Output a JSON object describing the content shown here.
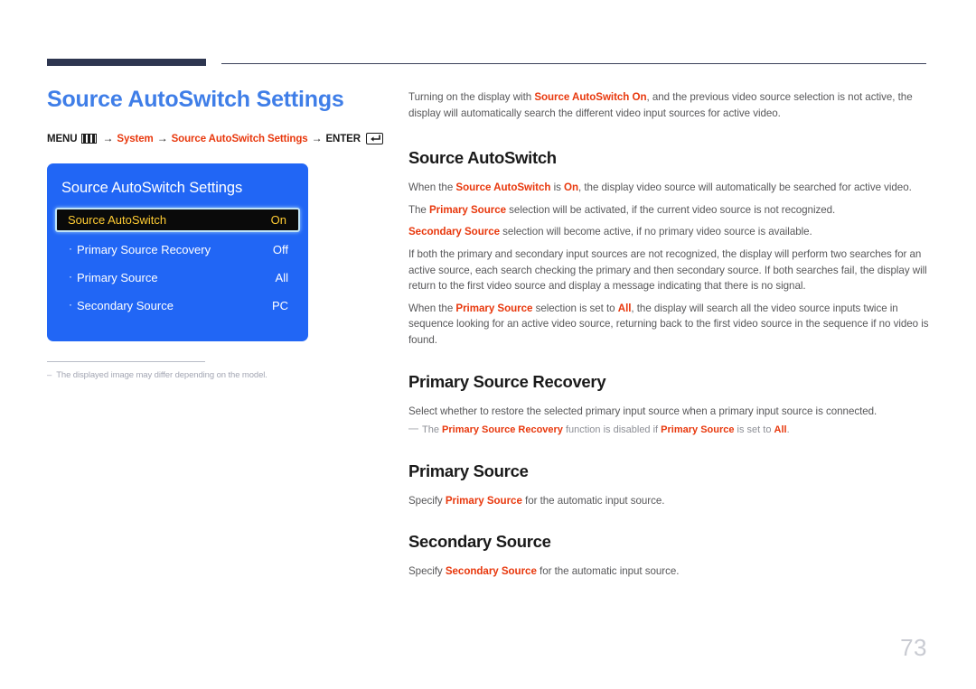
{
  "header": {
    "rule_color": "#2e3650"
  },
  "left": {
    "title": "Source AutoSwitch Settings",
    "menu_path": {
      "menu_label": "MENU",
      "menu_icon": "menu-grid-icon",
      "arrow": "→",
      "step1": "System",
      "step2": "Source AutoSwitch Settings",
      "enter_label": "ENTER",
      "enter_icon": "enter-return-icon"
    },
    "osd": {
      "title": "Source AutoSwitch Settings",
      "accent_color": "#2166f5",
      "highlight_text_color": "#ffcc33",
      "rows": [
        {
          "bullet": "",
          "label": "Source AutoSwitch",
          "value": "On",
          "selected": true
        },
        {
          "bullet": "·",
          "label": "Primary Source Recovery",
          "value": "Off",
          "selected": false
        },
        {
          "bullet": "·",
          "label": "Primary Source",
          "value": "All",
          "selected": false
        },
        {
          "bullet": "·",
          "label": "Secondary Source",
          "value": "PC",
          "selected": false
        }
      ]
    },
    "note": {
      "dash": "–",
      "text": "The displayed image may differ depending on the model."
    }
  },
  "right": {
    "intro": {
      "part1": "Turning on the display with ",
      "accent1": "Source AutoSwitch On",
      "part2": ", and the previous video source selection is not active, the display will automatically search the different video input sources for active video."
    },
    "sections": [
      {
        "heading": "Source AutoSwitch",
        "paragraphs": [
          {
            "p1": "When the ",
            "a1": "Source AutoSwitch",
            "p2": " is ",
            "a2": "On",
            "p3": ", the display video source will automatically be searched for active video."
          },
          {
            "p1": "The ",
            "a1": "Primary Source",
            "p2": " selection will be activated, if the current video source is not recognized.",
            "a2": "",
            "p3": ""
          },
          {
            "p1": "",
            "a1": "Secondary Source",
            "p2": " selection will become active, if no primary video source is available.",
            "a2": "",
            "p3": ""
          },
          {
            "p1": "If both the primary and secondary input sources are not recognized, the display will perform two searches for an active source, each search checking the primary and then secondary source. If both searches fail, the display will return to the first video source and display a message indicating that there is no signal.",
            "a1": "",
            "p2": "",
            "a2": "",
            "p3": ""
          },
          {
            "p1": "When the ",
            "a1": "Primary Source",
            "p2": " selection is set to ",
            "a2": "All",
            "p3": ", the display will search all the video source inputs twice in sequence looking for an active video source, returning back to the first video source in the sequence if no video is found."
          }
        ]
      }
    ],
    "recovery": {
      "heading": "Primary Source Recovery",
      "body": "Select whether to restore the selected primary input source when a primary input source is connected.",
      "note_dash": "—",
      "note_p1": "The ",
      "note_a1": "Primary Source Recovery",
      "note_p2": " function is disabled if ",
      "note_a2": "Primary Source",
      "note_p3": " is set to ",
      "note_a3": "All",
      "note_p4": "."
    },
    "primary_source": {
      "heading": "Primary Source",
      "p1": "Specify ",
      "a1": "Primary Source",
      "p2": " for the automatic input source."
    },
    "secondary_source": {
      "heading": "Secondary Source",
      "p1": "Specify ",
      "a1": "Secondary Source",
      "p2": " for the automatic input source."
    }
  },
  "footer": {
    "page_number": "73"
  }
}
